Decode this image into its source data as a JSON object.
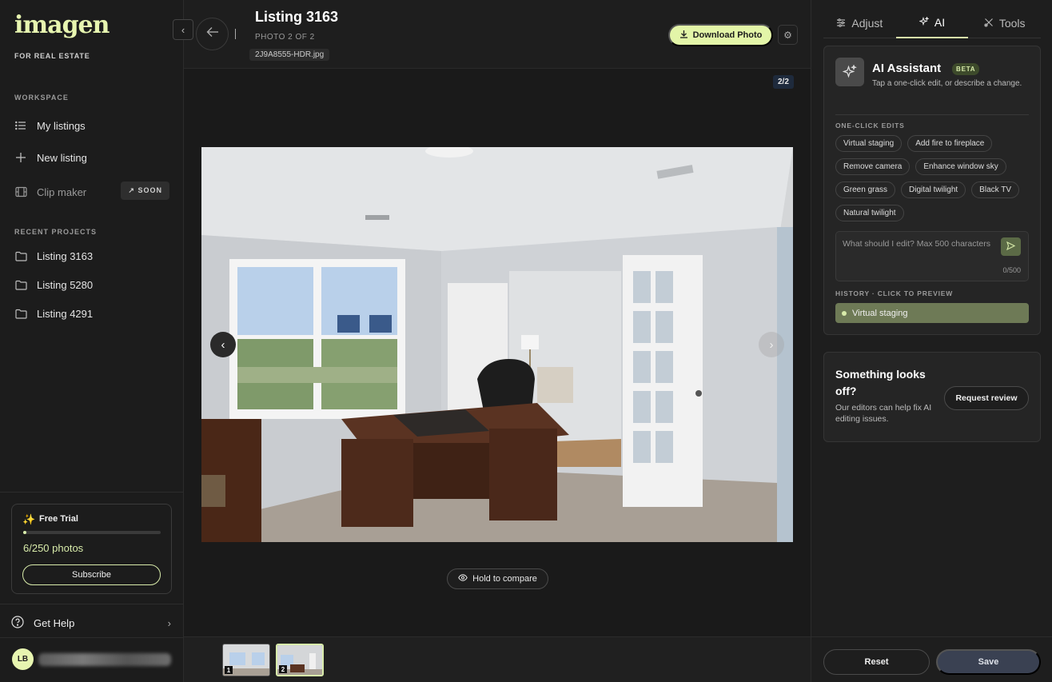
{
  "brand": {
    "logo": "imagen",
    "subtitle": "FOR REAL ESTATE"
  },
  "sidebar": {
    "workspace_label": "WORKSPACE",
    "workspace_items": [
      {
        "label": "My listings",
        "icon": "list-icon"
      },
      {
        "label": "New listing",
        "icon": "plus-icon"
      },
      {
        "label": "Clip maker",
        "icon": "film-icon",
        "badge": "SOON"
      }
    ],
    "recent_label": "RECENT PROJECTS",
    "recent_items": [
      {
        "label": "Listing 3163",
        "icon": "folder-icon"
      },
      {
        "label": "Listing 5280",
        "icon": "folder-icon"
      },
      {
        "label": "Listing 4291",
        "icon": "folder-icon"
      }
    ],
    "trial": {
      "title": "Free Trial",
      "count": "6/250 photos",
      "progress": 0.024,
      "subscribe_label": "Subscribe"
    },
    "help_label": "Get Help",
    "user_initials": "LB"
  },
  "header": {
    "title": "Listing 3163",
    "photo_label": "PHOTO 2 OF 2",
    "filename": "2J9A8555-HDR.jpg",
    "download_label": "Download Photo"
  },
  "viewer": {
    "counter": "2/2",
    "compare_label": "Hold to compare"
  },
  "filmstrip": {
    "thumbs": [
      {
        "num": "1"
      },
      {
        "num": "2"
      }
    ],
    "active_index": 1
  },
  "panel": {
    "tabs": [
      {
        "label": "Adjust",
        "icon": "sliders-icon"
      },
      {
        "label": "AI",
        "icon": "sparkle-icon"
      },
      {
        "label": "Tools",
        "icon": "tools-icon"
      }
    ],
    "active_tab": "AI",
    "assistant": {
      "title": "AI Assistant",
      "badge": "BETA",
      "description": "Tap a one-click edit, or describe a change.",
      "one_click_label": "ONE-CLICK EDITS",
      "chips": [
        "Virtual staging",
        "Add fire to fireplace",
        "Remove camera",
        "Enhance window sky",
        "Green grass",
        "Digital twilight",
        "Black TV",
        "Natural twilight"
      ],
      "prompt_placeholder": "What should I edit? Max 500 characters",
      "char_count": "0/500",
      "history_label": "HISTORY · CLICK TO PREVIEW",
      "history_items": [
        "Virtual staging"
      ]
    },
    "review": {
      "title": "Something looks off?",
      "description": "Our editors can help fix AI editing issues.",
      "button_label": "Request review"
    },
    "reset_label": "Reset",
    "save_label": "Save"
  },
  "colors": {
    "accent": "#e3f5a8",
    "history": "#6e7a56",
    "save": "#3a4152"
  }
}
